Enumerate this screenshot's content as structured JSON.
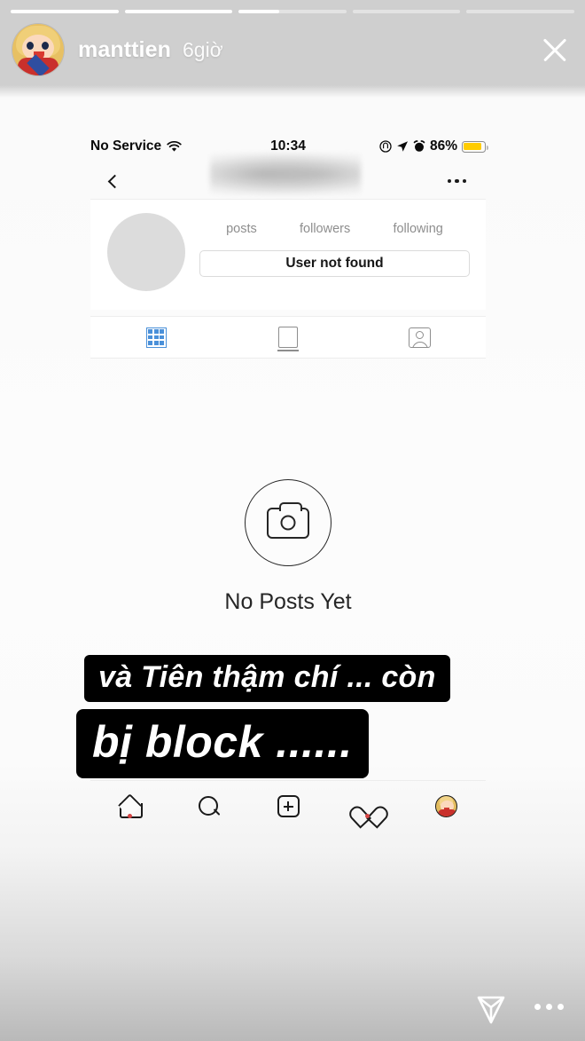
{
  "story": {
    "username": "manttien",
    "timestamp": "6giờ",
    "close_label": "×",
    "progress_segments": [
      100,
      100,
      38,
      0,
      0
    ],
    "avatar_name": "cartoon-character-avatar",
    "send_icon": "send-paper-plane-icon",
    "more_icon": "more-options-icon"
  },
  "phone": {
    "status_bar": {
      "carrier": "No Service",
      "wifi_icon": "wifi-icon",
      "time": "10:34",
      "do_not_disturb_icon": "do-not-disturb-icon",
      "location_icon": "location-arrow-icon",
      "alarm_icon": "alarm-clock-icon",
      "battery_percent": "86%",
      "battery_level": 86,
      "battery_color": "#ffcc00"
    },
    "navbar": {
      "back_icon": "back-chevron-icon",
      "title": "",
      "title_state": "blurred-redacted",
      "more_icon": "more-options-icon"
    },
    "profile": {
      "avatar_state": "empty-placeholder",
      "stats": [
        {
          "label": "posts",
          "value": ""
        },
        {
          "label": "followers",
          "value": ""
        },
        {
          "label": "following",
          "value": ""
        }
      ],
      "action_button": "User not found"
    },
    "tabs": [
      {
        "name": "grid",
        "icon": "grid-icon",
        "active": true,
        "color": "#4a90d9"
      },
      {
        "name": "igtv",
        "icon": "igtv-icon",
        "active": false,
        "color": "#8e8e8e"
      },
      {
        "name": "tagged",
        "icon": "tagged-person-icon",
        "active": false,
        "color": "#8e8e8e"
      }
    ],
    "empty_state": {
      "icon": "camera-icon",
      "text": "No Posts Yet"
    },
    "tabbar": [
      {
        "name": "home",
        "icon": "home-icon",
        "badge": true
      },
      {
        "name": "search",
        "icon": "search-icon",
        "badge": false
      },
      {
        "name": "create",
        "icon": "plus-square-icon",
        "badge": false
      },
      {
        "name": "activity",
        "icon": "heart-icon",
        "badge": true
      },
      {
        "name": "profile",
        "icon": "profile-avatar-icon",
        "badge": false
      }
    ]
  },
  "caption": {
    "line1": "và Tiên thậm chí ... còn",
    "line2": "bị block ......",
    "background": "#000000",
    "text_color": "#ffffff"
  }
}
